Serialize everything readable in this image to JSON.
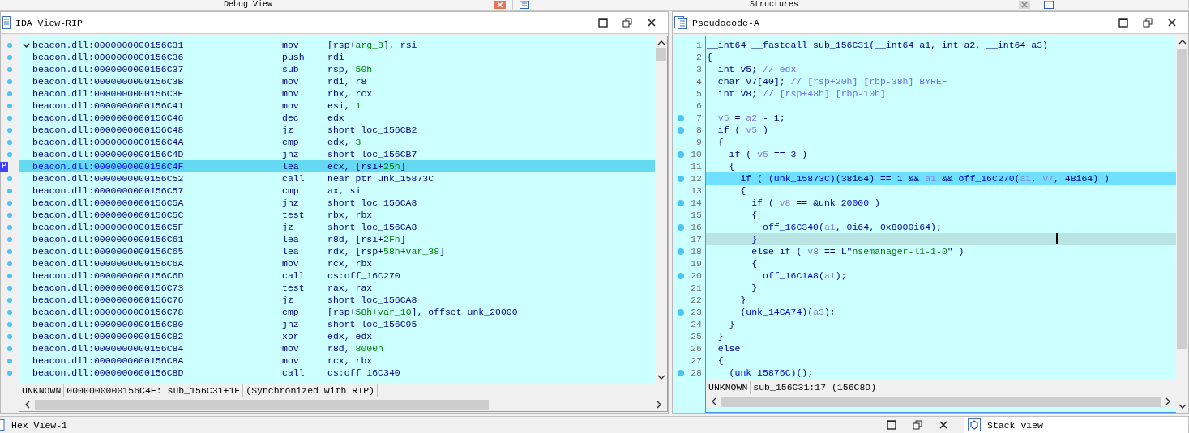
{
  "top_tabs": [
    {
      "label": "Debug View"
    },
    {
      "label": "Structures"
    }
  ],
  "disasm": {
    "title": "IDA View-RIP",
    "ip_marker": "P",
    "rows": [
      {
        "address": "beacon.dll:0000000000156C31",
        "mnemonic": "mov",
        "operands": [
          {
            "text": "[rsp+",
            "kind": "plain"
          },
          {
            "text": "arg_8",
            "kind": "number"
          },
          {
            "text": "], rsi",
            "kind": "plain"
          }
        ],
        "selected": false,
        "foldable": true
      },
      {
        "address": "beacon.dll:0000000000156C36",
        "mnemonic": "push",
        "operands": [
          {
            "text": "rdi",
            "kind": "plain"
          }
        ],
        "selected": false,
        "foldable": false
      },
      {
        "address": "beacon.dll:0000000000156C37",
        "mnemonic": "sub",
        "operands": [
          {
            "text": "rsp, ",
            "kind": "plain"
          },
          {
            "text": "50h",
            "kind": "number"
          }
        ],
        "selected": false,
        "foldable": false
      },
      {
        "address": "beacon.dll:0000000000156C3B",
        "mnemonic": "mov",
        "operands": [
          {
            "text": "rdi, r8",
            "kind": "plain"
          }
        ],
        "selected": false,
        "foldable": false
      },
      {
        "address": "beacon.dll:0000000000156C3E",
        "mnemonic": "mov",
        "operands": [
          {
            "text": "rbx, rcx",
            "kind": "plain"
          }
        ],
        "selected": false,
        "foldable": false
      },
      {
        "address": "beacon.dll:0000000000156C41",
        "mnemonic": "mov",
        "operands": [
          {
            "text": "esi, ",
            "kind": "plain"
          },
          {
            "text": "1",
            "kind": "number"
          }
        ],
        "selected": false,
        "foldable": false
      },
      {
        "address": "beacon.dll:0000000000156C46",
        "mnemonic": "dec",
        "operands": [
          {
            "text": "edx",
            "kind": "plain"
          }
        ],
        "selected": false,
        "foldable": false
      },
      {
        "address": "beacon.dll:0000000000156C48",
        "mnemonic": "jz",
        "operands": [
          {
            "text": "short loc_156CB2",
            "kind": "plain"
          }
        ],
        "selected": false,
        "foldable": false
      },
      {
        "address": "beacon.dll:0000000000156C4A",
        "mnemonic": "cmp",
        "operands": [
          {
            "text": "edx, ",
            "kind": "plain"
          },
          {
            "text": "3",
            "kind": "number"
          }
        ],
        "selected": false,
        "foldable": false
      },
      {
        "address": "beacon.dll:0000000000156C4D",
        "mnemonic": "jnz",
        "operands": [
          {
            "text": "short loc_156CB7",
            "kind": "plain"
          }
        ],
        "selected": false,
        "foldable": false
      },
      {
        "address": "beacon.dll:0000000000156C4F",
        "mnemonic": "lea",
        "operands": [
          {
            "text": "ecx, [rsi+",
            "kind": "plain"
          },
          {
            "text": "25h",
            "kind": "number"
          },
          {
            "text": "]",
            "kind": "plain"
          }
        ],
        "selected": true,
        "foldable": false
      },
      {
        "address": "beacon.dll:0000000000156C52",
        "mnemonic": "call",
        "operands": [
          {
            "text": "near ptr unk_15873C",
            "kind": "plain"
          }
        ],
        "selected": false,
        "foldable": false
      },
      {
        "address": "beacon.dll:0000000000156C57",
        "mnemonic": "cmp",
        "operands": [
          {
            "text": "ax, si",
            "kind": "plain"
          }
        ],
        "selected": false,
        "foldable": false
      },
      {
        "address": "beacon.dll:0000000000156C5A",
        "mnemonic": "jnz",
        "operands": [
          {
            "text": "short loc_156CA8",
            "kind": "plain"
          }
        ],
        "selected": false,
        "foldable": false
      },
      {
        "address": "beacon.dll:0000000000156C5C",
        "mnemonic": "test",
        "operands": [
          {
            "text": "rbx, rbx",
            "kind": "plain"
          }
        ],
        "selected": false,
        "foldable": false
      },
      {
        "address": "beacon.dll:0000000000156C5F",
        "mnemonic": "jz",
        "operands": [
          {
            "text": "short loc_156CA8",
            "kind": "plain"
          }
        ],
        "selected": false,
        "foldable": false
      },
      {
        "address": "beacon.dll:0000000000156C61",
        "mnemonic": "lea",
        "operands": [
          {
            "text": "r8d, [rsi+",
            "kind": "plain"
          },
          {
            "text": "2Fh",
            "kind": "number"
          },
          {
            "text": "]",
            "kind": "plain"
          }
        ],
        "selected": false,
        "foldable": false
      },
      {
        "address": "beacon.dll:0000000000156C65",
        "mnemonic": "lea",
        "operands": [
          {
            "text": "rdx, [rsp+",
            "kind": "plain"
          },
          {
            "text": "58h+var_38",
            "kind": "number"
          },
          {
            "text": "]",
            "kind": "plain"
          }
        ],
        "selected": false,
        "foldable": false
      },
      {
        "address": "beacon.dll:0000000000156C6A",
        "mnemonic": "mov",
        "operands": [
          {
            "text": "rcx, rbx",
            "kind": "plain"
          }
        ],
        "selected": false,
        "foldable": false
      },
      {
        "address": "beacon.dll:0000000000156C6D",
        "mnemonic": "call",
        "operands": [
          {
            "text": "cs:off_16C270",
            "kind": "plain"
          }
        ],
        "selected": false,
        "foldable": false
      },
      {
        "address": "beacon.dll:0000000000156C73",
        "mnemonic": "test",
        "operands": [
          {
            "text": "rax, rax",
            "kind": "plain"
          }
        ],
        "selected": false,
        "foldable": false
      },
      {
        "address": "beacon.dll:0000000000156C76",
        "mnemonic": "jz",
        "operands": [
          {
            "text": "short loc_156CA8",
            "kind": "plain"
          }
        ],
        "selected": false,
        "foldable": false
      },
      {
        "address": "beacon.dll:0000000000156C78",
        "mnemonic": "cmp",
        "operands": [
          {
            "text": "[rsp+",
            "kind": "plain"
          },
          {
            "text": "58h+var_10",
            "kind": "number"
          },
          {
            "text": "], offset unk_20000",
            "kind": "plain"
          }
        ],
        "selected": false,
        "foldable": false
      },
      {
        "address": "beacon.dll:0000000000156C80",
        "mnemonic": "jnz",
        "operands": [
          {
            "text": "short loc_156C95",
            "kind": "plain"
          }
        ],
        "selected": false,
        "foldable": false
      },
      {
        "address": "beacon.dll:0000000000156C82",
        "mnemonic": "xor",
        "operands": [
          {
            "text": "edx, edx",
            "kind": "plain"
          }
        ],
        "selected": false,
        "foldable": false
      },
      {
        "address": "beacon.dll:0000000000156C84",
        "mnemonic": "mov",
        "operands": [
          {
            "text": "r8d, ",
            "kind": "plain"
          },
          {
            "text": "8000h",
            "kind": "number"
          }
        ],
        "selected": false,
        "foldable": false
      },
      {
        "address": "beacon.dll:0000000000156C8A",
        "mnemonic": "mov",
        "operands": [
          {
            "text": "rcx, rbx",
            "kind": "plain"
          }
        ],
        "selected": false,
        "foldable": false
      },
      {
        "address": "beacon.dll:0000000000156C8D",
        "mnemonic": "call",
        "operands": [
          {
            "text": "cs:off_16C340",
            "kind": "plain"
          }
        ],
        "selected": false,
        "foldable": false
      }
    ],
    "status": [
      "UNKNOWN",
      "0000000000156C4F: sub_156C31+1E",
      "(Synchronized with RIP)"
    ]
  },
  "pseudocode": {
    "title": "Pseudocode-A",
    "lines": [
      {
        "n": "1",
        "breakpoint": false,
        "selected": false,
        "current": false,
        "code": [
          {
            "text": "__int64 __fastcall sub_156C31(__int64 a1, int a2, __int64 a3)",
            "kind": "plain"
          }
        ]
      },
      {
        "n": "2",
        "breakpoint": false,
        "selected": false,
        "current": false,
        "code": [
          {
            "text": "{",
            "kind": "plain"
          }
        ]
      },
      {
        "n": "3",
        "breakpoint": false,
        "selected": false,
        "current": false,
        "code": [
          {
            "text": "  int v5; ",
            "kind": "plain"
          },
          {
            "text": "// edx",
            "kind": "comment"
          }
        ]
      },
      {
        "n": "4",
        "breakpoint": false,
        "selected": false,
        "current": false,
        "code": [
          {
            "text": "  char v7[40]; ",
            "kind": "plain"
          },
          {
            "text": "// [rsp+20h] [rbp-38h] BYREF",
            "kind": "comment"
          }
        ]
      },
      {
        "n": "5",
        "breakpoint": false,
        "selected": false,
        "current": false,
        "code": [
          {
            "text": "  int v8; ",
            "kind": "plain"
          },
          {
            "text": "// [rsp+48h] [rbp-10h]",
            "kind": "comment"
          }
        ]
      },
      {
        "n": "6",
        "breakpoint": false,
        "selected": false,
        "current": false
      },
      {
        "n": "7",
        "breakpoint": true,
        "selected": false,
        "current": false,
        "code": [
          {
            "text": "  v5",
            "kind": "var"
          },
          {
            "text": " = ",
            "kind": "plain"
          },
          {
            "text": "a2",
            "kind": "var"
          },
          {
            "text": " - 1;",
            "kind": "plain"
          }
        ]
      },
      {
        "n": "8",
        "breakpoint": true,
        "selected": false,
        "current": false,
        "code": [
          {
            "text": "  if ( ",
            "kind": "plain"
          },
          {
            "text": "v5",
            "kind": "var"
          },
          {
            "text": " )",
            "kind": "plain"
          }
        ]
      },
      {
        "n": "9",
        "breakpoint": false,
        "selected": false,
        "current": false,
        "code": [
          {
            "text": "  {",
            "kind": "plain"
          }
        ]
      },
      {
        "n": "10",
        "breakpoint": true,
        "selected": false,
        "current": false,
        "code": [
          {
            "text": "    if ( ",
            "kind": "plain"
          },
          {
            "text": "v5",
            "kind": "var"
          },
          {
            "text": " == 3 )",
            "kind": "plain"
          }
        ]
      },
      {
        "n": "11",
        "breakpoint": false,
        "selected": false,
        "current": false,
        "code": [
          {
            "text": "    {",
            "kind": "plain"
          }
        ]
      },
      {
        "n": "12",
        "breakpoint": true,
        "selected": true,
        "current": false,
        "code": [
          {
            "text": "      if ( (",
            "kind": "plain"
          },
          {
            "text": "unk_15873C",
            "kind": "func"
          },
          {
            "text": ")(38i64) == 1 && ",
            "kind": "plain"
          },
          {
            "text": "a1",
            "kind": "var"
          },
          {
            "text": " && ",
            "kind": "plain"
          },
          {
            "text": "off_16C270",
            "kind": "func"
          },
          {
            "text": "(",
            "kind": "plain"
          },
          {
            "text": "a1",
            "kind": "var"
          },
          {
            "text": ", ",
            "kind": "plain"
          },
          {
            "text": "v7",
            "kind": "var"
          },
          {
            "text": ", 48i64) )",
            "kind": "plain"
          }
        ]
      },
      {
        "n": "13",
        "breakpoint": false,
        "selected": false,
        "current": false,
        "code": [
          {
            "text": "      {",
            "kind": "plain"
          }
        ]
      },
      {
        "n": "14",
        "breakpoint": true,
        "selected": false,
        "current": false,
        "code": [
          {
            "text": "        if ( ",
            "kind": "plain"
          },
          {
            "text": "v8",
            "kind": "var"
          },
          {
            "text": " == &",
            "kind": "plain"
          },
          {
            "text": "unk_20000",
            "kind": "func"
          },
          {
            "text": " )",
            "kind": "plain"
          }
        ]
      },
      {
        "n": "15",
        "breakpoint": false,
        "selected": false,
        "current": false,
        "code": [
          {
            "text": "        {",
            "kind": "plain"
          }
        ]
      },
      {
        "n": "16",
        "breakpoint": true,
        "selected": false,
        "current": false,
        "code": [
          {
            "text": "          off_16C340",
            "kind": "func"
          },
          {
            "text": "(",
            "kind": "plain"
          },
          {
            "text": "a1",
            "kind": "var"
          },
          {
            "text": ", 0i64, 0x8000i64);",
            "kind": "plain"
          }
        ]
      },
      {
        "n": "17",
        "breakpoint": false,
        "selected": false,
        "current": true,
        "code": [
          {
            "text": "        }",
            "kind": "plain"
          }
        ]
      },
      {
        "n": "18",
        "breakpoint": true,
        "selected": false,
        "current": false,
        "code": [
          {
            "text": "        else if ( ",
            "kind": "plain"
          },
          {
            "text": "v8",
            "kind": "var"
          },
          {
            "text": " == L\"",
            "kind": "plain"
          },
          {
            "text": "nsemanager-l1-1-0",
            "kind": "string"
          },
          {
            "text": "\" )",
            "kind": "plain"
          }
        ]
      },
      {
        "n": "19",
        "breakpoint": false,
        "selected": false,
        "current": false,
        "code": [
          {
            "text": "        {",
            "kind": "plain"
          }
        ]
      },
      {
        "n": "20",
        "breakpoint": true,
        "selected": false,
        "current": false,
        "code": [
          {
            "text": "          off_16C1A8",
            "kind": "func"
          },
          {
            "text": "(",
            "kind": "plain"
          },
          {
            "text": "a1",
            "kind": "var"
          },
          {
            "text": ");",
            "kind": "plain"
          }
        ]
      },
      {
        "n": "21",
        "breakpoint": false,
        "selected": false,
        "current": false,
        "code": [
          {
            "text": "        }",
            "kind": "plain"
          }
        ]
      },
      {
        "n": "22",
        "breakpoint": false,
        "selected": false,
        "current": false,
        "code": [
          {
            "text": "      }",
            "kind": "plain"
          }
        ]
      },
      {
        "n": "23",
        "breakpoint": true,
        "selected": false,
        "current": false,
        "code": [
          {
            "text": "      (",
            "kind": "plain"
          },
          {
            "text": "unk_14CA74",
            "kind": "func"
          },
          {
            "text": ")(",
            "kind": "plain"
          },
          {
            "text": "a3",
            "kind": "var"
          },
          {
            "text": ");",
            "kind": "plain"
          }
        ]
      },
      {
        "n": "24",
        "breakpoint": false,
        "selected": false,
        "current": false,
        "code": [
          {
            "text": "    }",
            "kind": "plain"
          }
        ]
      },
      {
        "n": "25",
        "breakpoint": false,
        "selected": false,
        "current": false,
        "code": [
          {
            "text": "  }",
            "kind": "plain"
          }
        ]
      },
      {
        "n": "26",
        "breakpoint": false,
        "selected": false,
        "current": false,
        "code": [
          {
            "text": "  else",
            "kind": "plain"
          }
        ]
      },
      {
        "n": "27",
        "breakpoint": false,
        "selected": false,
        "current": false,
        "code": [
          {
            "text": "  {",
            "kind": "plain"
          }
        ]
      },
      {
        "n": "28",
        "breakpoint": true,
        "selected": false,
        "current": false,
        "code": [
          {
            "text": "    (",
            "kind": "plain"
          },
          {
            "text": "unk_15876C",
            "kind": "func"
          },
          {
            "text": ")();",
            "kind": "plain"
          }
        ]
      }
    ],
    "status": [
      "UNKNOWN",
      "sub_156C31:17 (156C8D)"
    ]
  },
  "bottom_panels": [
    {
      "title": "Hex View-1"
    },
    {
      "title": "Stack view"
    }
  ]
}
